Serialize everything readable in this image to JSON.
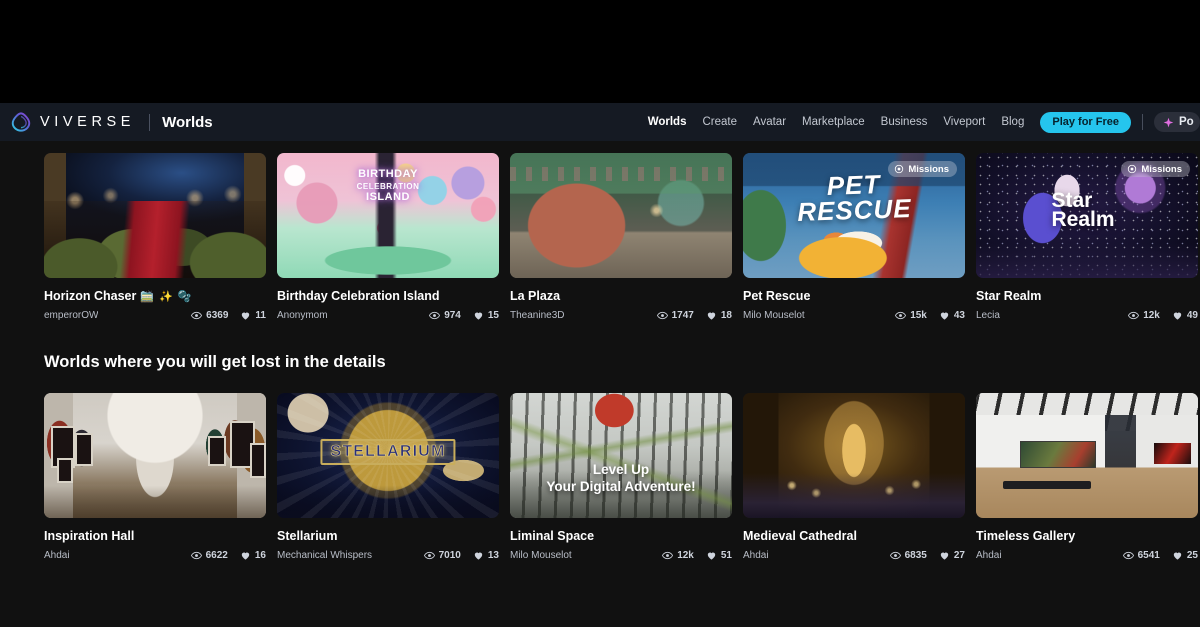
{
  "header": {
    "brand_wordmark": "VIVERSE",
    "section_name": "Worlds",
    "logo_icon": "viverse-logo-icon",
    "nav": [
      {
        "label": "Worlds",
        "active": true
      },
      {
        "label": "Create",
        "active": false
      },
      {
        "label": "Avatar",
        "active": false
      },
      {
        "label": "Marketplace",
        "active": false
      },
      {
        "label": "Business",
        "active": false
      },
      {
        "label": "Viveport",
        "active": false
      },
      {
        "label": "Blog",
        "active": false
      }
    ],
    "cta_label": "Play for Free",
    "points_label": "Po",
    "points_icon": "sparkle-icon",
    "cta_color": "#25c5ed",
    "sparkle_color": "#e06ee0"
  },
  "sections": [
    {
      "heading": "",
      "cards": [
        {
          "title": "Horizon Chaser",
          "emoji": "🚞 ✨ 🫧",
          "author": "emperorOW",
          "views": "6369",
          "likes": "11",
          "badge": null,
          "art": "art-train"
        },
        {
          "title": "Birthday Celebration Island",
          "emoji": "",
          "author": "Anonymom",
          "views": "974",
          "likes": "15",
          "badge": null,
          "art": "art-birthday",
          "overlay_text": "BIRTHDAY CELEBRATION ISLAND"
        },
        {
          "title": "La Plaza",
          "emoji": "",
          "author": "Theanine3D",
          "views": "1747",
          "likes": "18",
          "badge": null,
          "art": "art-plaza"
        },
        {
          "title": "Pet Rescue",
          "emoji": "",
          "author": "Milo Mouselot",
          "views": "15k",
          "likes": "43",
          "badge": "Missions",
          "art": "art-pet",
          "overlay_text": "PET RESCUE"
        },
        {
          "title": "Star Realm",
          "emoji": "",
          "author": "Lecia",
          "views": "12k",
          "likes": "49",
          "badge": "Missions",
          "art": "art-star",
          "overlay_text": "Star Realm"
        }
      ]
    },
    {
      "heading": "Worlds where you will get lost in the details",
      "cards": [
        {
          "title": "Inspiration Hall",
          "emoji": "",
          "author": "Ahdai",
          "views": "6622",
          "likes": "16",
          "badge": null,
          "art": "art-hall"
        },
        {
          "title": "Stellarium",
          "emoji": "",
          "author": "Mechanical Whispers",
          "views": "7010",
          "likes": "13",
          "badge": null,
          "art": "art-stellar",
          "overlay_text": "STELLARIUM"
        },
        {
          "title": "Liminal Space",
          "emoji": "",
          "author": "Milo Mouselot",
          "views": "12k",
          "likes": "51",
          "badge": null,
          "art": "art-liminal",
          "overlay_text": "Level Up\nYour Digital Adventure!"
        },
        {
          "title": "Medieval Cathedral",
          "emoji": "",
          "author": "Ahdai",
          "views": "6835",
          "likes": "27",
          "badge": null,
          "art": "art-cathedral"
        },
        {
          "title": "Timeless Gallery",
          "emoji": "",
          "author": "Ahdai",
          "views": "6541",
          "likes": "25",
          "badge": null,
          "art": "art-timeless"
        }
      ]
    }
  ],
  "icons": {
    "views": "eye-icon",
    "likes": "heart-icon",
    "missions": "target-icon"
  }
}
